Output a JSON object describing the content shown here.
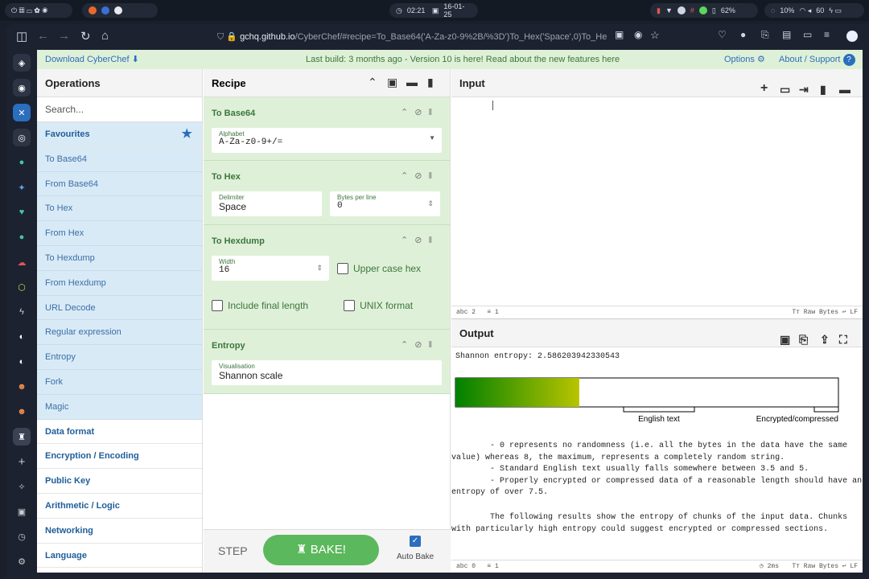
{
  "system": {
    "clock": "02:21",
    "date": "16-01-25",
    "battery": "62%",
    "cpu": "10%",
    "wifi": "60"
  },
  "browser": {
    "url_host": "gchq.github.io",
    "url_path": "/CyberChef/#recipe=To_Base64('A-Za-z0-9%2B/%3D')To_Hex('Space',0)To_He"
  },
  "banner": {
    "download": "Download CyberChef",
    "center": "Last build: 3 months ago - Version 10 is here! Read about the new features here",
    "options": "Options",
    "about": "About / Support"
  },
  "operations": {
    "title": "Operations",
    "search_placeholder": "Search...",
    "favourites": "Favourites",
    "items": [
      "To Base64",
      "From Base64",
      "To Hex",
      "From Hex",
      "To Hexdump",
      "From Hexdump",
      "URL Decode",
      "Regular expression",
      "Entropy",
      "Fork",
      "Magic"
    ],
    "categories": [
      "Data format",
      "Encryption / Encoding",
      "Public Key",
      "Arithmetic / Logic",
      "Networking",
      "Language"
    ]
  },
  "recipe": {
    "title": "Recipe",
    "ops": {
      "b64": {
        "title": "To Base64",
        "label": "Alphabet",
        "value": "A-Za-z0-9+/="
      },
      "hex": {
        "title": "To Hex",
        "delim_label": "Delimiter",
        "delim_value": "Space",
        "bpl_label": "Bytes per line",
        "bpl_value": "0"
      },
      "hexdump": {
        "title": "To Hexdump",
        "width_label": "Width",
        "width_value": "16",
        "upper": "Upper case hex",
        "final": "Include final length",
        "unix": "UNIX format"
      },
      "entropy": {
        "title": "Entropy",
        "label": "Visualisation",
        "value": "Shannon scale"
      }
    },
    "step": "STEP",
    "bake": "BAKE!",
    "autobake": "Auto Bake"
  },
  "input": {
    "title": "Input",
    "status_len": "2",
    "status_lines": "1",
    "raw": "Raw Bytes",
    "eol": "LF"
  },
  "output": {
    "title": "Output",
    "entropy_line": "Shannon entropy: 2.586203942330543",
    "entropy_value": 2.586203942330543,
    "entropy_max": 8,
    "scale_english": "English text",
    "scale_encrypted": "Encrypted/compressed",
    "para1": "        - 0 represents no randomness (i.e. all the bytes in the data have the same\nvalue) whereas 8, the maximum, represents a completely random string.\n        - Standard English text usually falls somewhere between 3.5 and 5.\n        - Properly encrypted or compressed data of a reasonable length should have an\nentropy of over 7.5.",
    "para2": "        The following results show the entropy of chunks of the input data. Chunks\nwith particularly high entropy could suggest encrypted or compressed sections.",
    "status_len": "0",
    "status_lines": "1",
    "time": "2ms",
    "raw": "Raw Bytes",
    "eol": "LF"
  },
  "colors": {
    "op_green": "#dff0d8",
    "fav_blue": "#d9eaf7",
    "bake_green": "#5cb85c",
    "link_blue": "#2a6ebd"
  }
}
